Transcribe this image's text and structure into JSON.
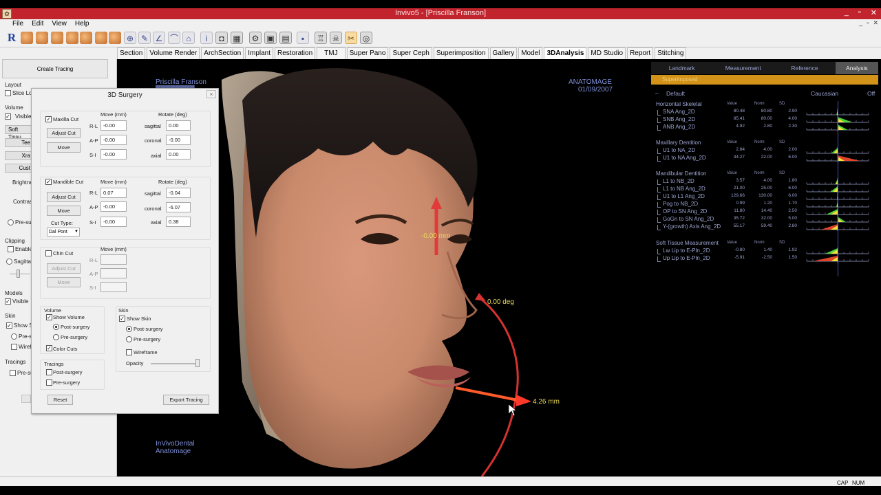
{
  "window": {
    "title": "Invivo5 - [Priscilla Franson]",
    "controls": [
      "_",
      "▫",
      "✕"
    ]
  },
  "menu": [
    "File",
    "Edit",
    "View",
    "Help"
  ],
  "tabs": [
    "Section",
    "Volume Render",
    "ArchSection",
    "Implant",
    "Restoration",
    "TMJ",
    "Super Pano",
    "Super Ceph",
    "Superimposition",
    "Gallery",
    "Model",
    "3DAnalysis",
    "MD Studio",
    "Report",
    "Stitching"
  ],
  "active_tab": "3DAnalysis",
  "left_panel": {
    "create_tracing": "Create Tracing",
    "layout": "Layout",
    "slice_locator": "Slice Loc",
    "volume": "Volume",
    "visible": "Visible",
    "soft_tissue": "Soft Tissu",
    "tee": "Tee",
    "xra": "Xra",
    "cust": "Cust",
    "brightness": "Brightne",
    "contrast": "Contrast",
    "pre_surgery": "Pre-sur",
    "clipping": "Clipping",
    "enable": "Enable",
    "sagittal": "Sagittal",
    "models": "Models",
    "models_visible": "Visible",
    "skin": "Skin",
    "show_skin": "Show Sk",
    "pre_s": "Pre-s",
    "wire": "Wirefr",
    "tracings": "Tracings",
    "pre_su": "Pre-su"
  },
  "viewport": {
    "patient_name": "Priscilla Franson",
    "patient_sub": "████████",
    "brand": "ANATOMAGE",
    "date": "01/09/2007",
    "footer_line1": "InVivoDental",
    "footer_line2": "Anatomage",
    "arrow_label_top": "-0.00 mm",
    "rotation_label": "0.00 deg",
    "arrow_label_right": "4.26 mm"
  },
  "dialog": {
    "title": "3D Surgery",
    "close": "×",
    "move_mm": "Move (mm)",
    "rotate_deg": "Rotate (deg)",
    "rl": "R-L",
    "ap": "A-P",
    "si": "S-I",
    "sagittal": "sagittal",
    "coronal": "coronal",
    "axial": "axial",
    "maxilla": {
      "label": "Maxilla Cut",
      "adjust": "Adjust Cut",
      "move": "Move",
      "rl": "-0.00",
      "ap": "-0.00",
      "si": "-0.00",
      "sagittal": "0.00",
      "coronal": "-0.00",
      "axial": "0.00"
    },
    "mandible": {
      "label": "Mandible Cut",
      "adjust": "Adjust Cut",
      "move": "Move",
      "cut_type_label": "Cut Type:",
      "cut_type": "Dal Pont",
      "rl": "0.07",
      "ap": "-0.00",
      "si": "-0.00",
      "sagittal": "-0.04",
      "coronal": "-6.07",
      "axial": "0.38"
    },
    "chin": {
      "label": "Chin Cut",
      "adjust": "Adjust Cut",
      "move": "Move"
    },
    "volume_section": {
      "title": "Volume",
      "show_volume": "Show Volume",
      "post": "Post-surgery",
      "pre": "Pre-surgery",
      "color_cuts": "Color Cuts"
    },
    "skin_section": {
      "title": "Skin",
      "show_skin": "Show Skin",
      "post": "Post-surgery",
      "pre": "Pre-surgery",
      "wireframe": "Wireframe",
      "opacity": "Opacity"
    },
    "tracings_section": {
      "title": "Tracings",
      "post": "Post-surgery",
      "pre": "Pre-surgery"
    },
    "reset": "Reset",
    "export": "Export Tracing"
  },
  "analysis": {
    "tabs": [
      "Landmark",
      "Measurement",
      "Reference",
      "Analysis"
    ],
    "active_tab": "Analysis",
    "banner": "Superimposed",
    "default_label": "Default",
    "norm_label": "Caucasian",
    "off_label": "Off",
    "col_value": "Value",
    "col_norm": "Norm",
    "col_sd": "SD",
    "groups": [
      {
        "title": "Horizontal Skeletal",
        "rows": [
          {
            "name": "SNA Ang_2D",
            "value": "80.48",
            "norm": "80.80",
            "sd": "2.90"
          },
          {
            "name": "SNB Ang_2D",
            "value": "85.41",
            "norm": "80.00",
            "sd": "4.00"
          },
          {
            "name": "ANB Ang_2D",
            "value": "4.92",
            "norm": "2.80",
            "sd": "2.30"
          }
        ]
      },
      {
        "title": "Maxillary Dentition",
        "rows": [
          {
            "name": "U1 to NA_2D",
            "value": "2.84",
            "norm": "4.00",
            "sd": "2.00"
          },
          {
            "name": "U1 to NA Ang_2D",
            "value": "34.27",
            "norm": "22.00",
            "sd": "6.00"
          }
        ]
      },
      {
        "title": "Mandibular Dentition",
        "rows": [
          {
            "name": "L1 to NB_2D",
            "value": "3.57",
            "norm": "4.00",
            "sd": "1.80"
          },
          {
            "name": "L1 to NB Ang_2D",
            "value": "21.00",
            "norm": "25.00",
            "sd": "6.00"
          },
          {
            "name": "U1 to L1 Ang_2D",
            "value": "129.66",
            "norm": "130.00",
            "sd": "6.00"
          },
          {
            "name": "Pog to NB_2D",
            "value": "0.99",
            "norm": "1.20",
            "sd": "1.70"
          },
          {
            "name": "OP to SN Ang_2D",
            "value": "11.80",
            "norm": "14.40",
            "sd": "2.50"
          },
          {
            "name": "GoGn to SN Ang_2D",
            "value": "35.72",
            "norm": "32.00",
            "sd": "5.00"
          },
          {
            "name": "Y-(growth) Axis Ang_2D",
            "value": "55.17",
            "norm": "59.40",
            "sd": "2.80"
          }
        ]
      },
      {
        "title": "Soft Tissue Measurement",
        "rows": [
          {
            "name": "Lw Lip to E-Pln_2D",
            "value": "-0.80",
            "norm": "1.40",
            "sd": "1.92"
          },
          {
            "name": "Up Lip to E-Pln_2D",
            "value": "-5.91",
            "norm": "-2.50",
            "sd": "1.50"
          }
        ]
      }
    ]
  },
  "status": [
    "CAP",
    "NUM"
  ],
  "colors": {
    "titlebar": "#c1242d",
    "banner": "#d39319",
    "analysis_text": "#9ca4d0",
    "viewport_text": "#7f8fd8",
    "arrow": "#e03a3a"
  }
}
